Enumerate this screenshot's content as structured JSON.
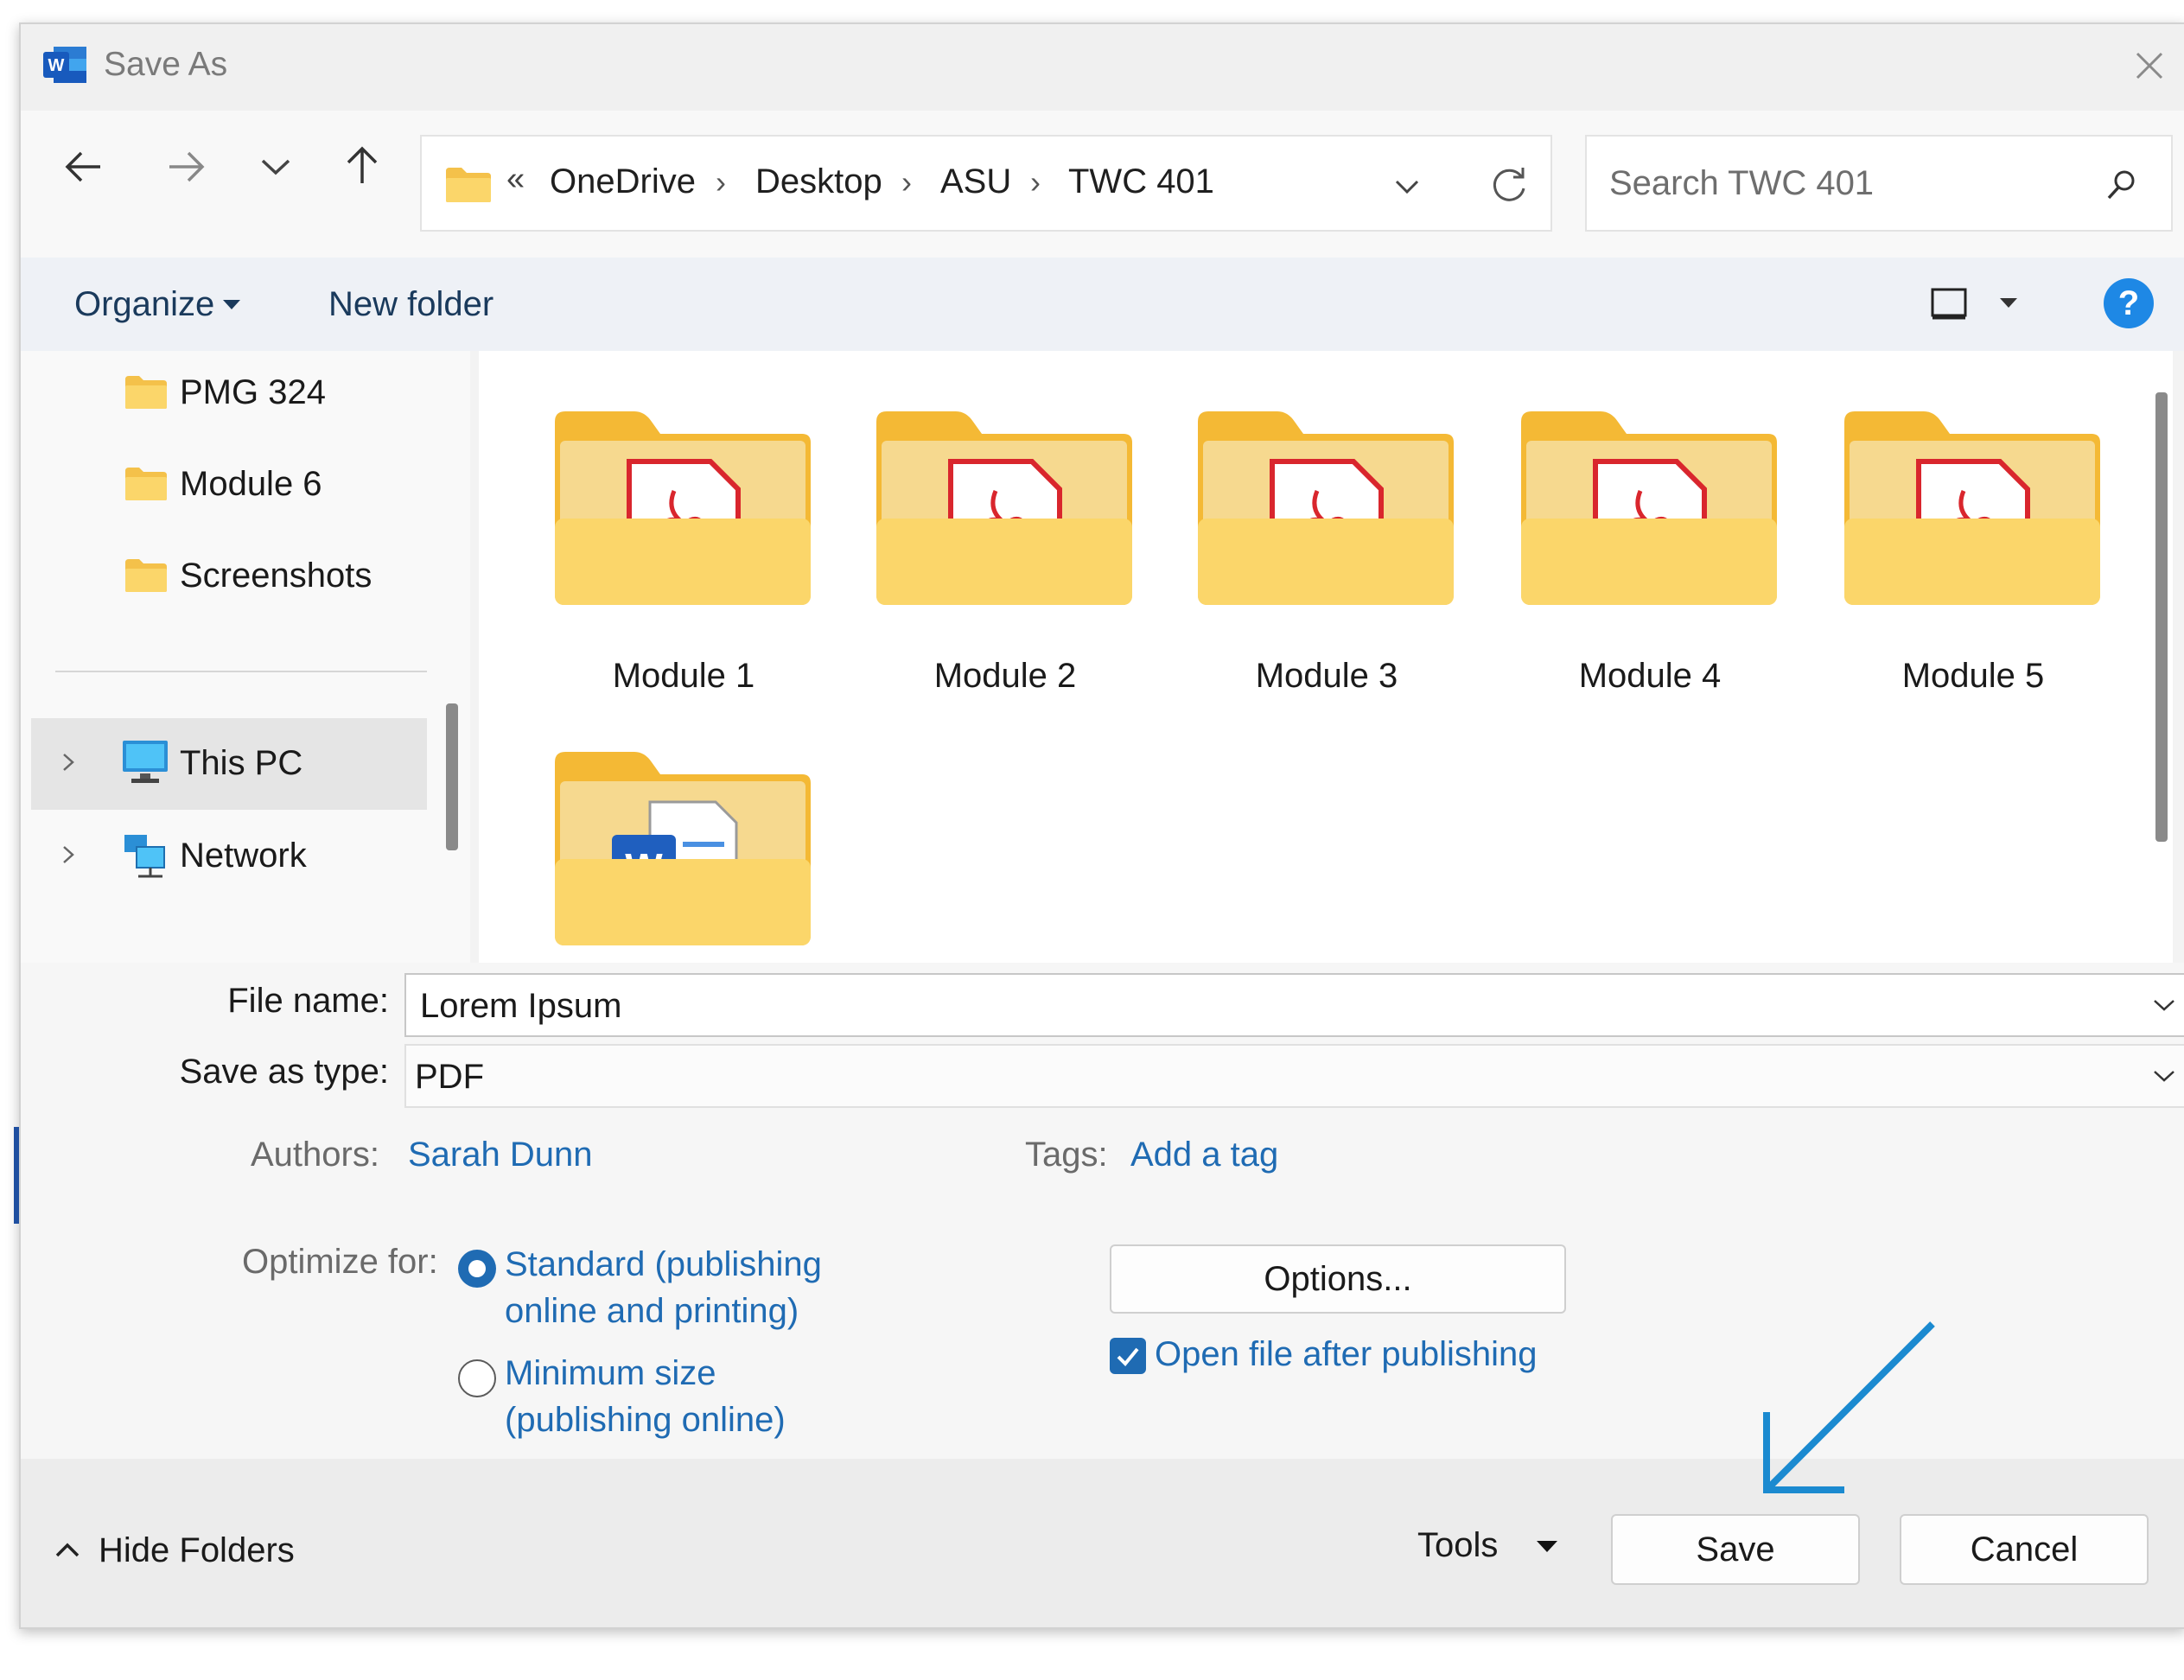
{
  "window": {
    "title": "Save As",
    "app_icon": "word-icon",
    "close_icon": "close-icon"
  },
  "nav": {
    "back_icon": "arrow-left-icon",
    "forward_icon": "arrow-right-icon",
    "recent_icon": "chevron-down-icon",
    "up_icon": "arrow-up-icon",
    "breadcrumb_prefix": "«",
    "breadcrumb": [
      "OneDrive",
      "Desktop",
      "ASU",
      "TWC 401"
    ],
    "separator": "›",
    "refresh_icon": "refresh-icon"
  },
  "search": {
    "placeholder": "Search TWC 401",
    "icon": "search-icon"
  },
  "toolbar": {
    "organize_label": "Organize",
    "new_folder_label": "New folder",
    "view_icon": "view-icon",
    "help_label": "?"
  },
  "sidebar": {
    "folders": [
      "PMG 324",
      "Module 6",
      "Screenshots"
    ],
    "locations": [
      {
        "label": "This PC",
        "icon": "monitor-icon",
        "selected": true
      },
      {
        "label": "Network",
        "icon": "network-icon",
        "selected": false
      }
    ]
  },
  "content": {
    "folders": [
      {
        "label": "Module 1",
        "icon": "pdf-folder-icon"
      },
      {
        "label": "Module 2",
        "icon": "pdf-folder-icon"
      },
      {
        "label": "Module 3",
        "icon": "pdf-folder-icon"
      },
      {
        "label": "Module 4",
        "icon": "pdf-folder-icon"
      },
      {
        "label": "Module 5",
        "icon": "pdf-folder-icon"
      }
    ],
    "partial_folder_icon": "word-folder-icon"
  },
  "form": {
    "file_name_label": "File name:",
    "file_name_value": "Lorem Ipsum",
    "save_type_label": "Save as type:",
    "save_type_value": "PDF",
    "authors_label": "Authors:",
    "authors_value": "Sarah Dunn",
    "tags_label": "Tags:",
    "tags_value": "Add a tag",
    "optimize_label": "Optimize for:",
    "optimize_options": [
      {
        "line1": "Standard (publishing",
        "line2": "online and printing)",
        "selected": true
      },
      {
        "line1": "Minimum size",
        "line2": "(publishing online)",
        "selected": false
      }
    ],
    "options_button": "Options...",
    "open_after_label": "Open file after publishing",
    "open_after_checked": true
  },
  "footer": {
    "hide_folders_label": "Hide Folders",
    "tools_label": "Tools",
    "save_label": "Save",
    "cancel_label": "Cancel"
  },
  "colors": {
    "accent": "#1f6bb3",
    "annotation_arrow": "#1b8ad0",
    "folder_yellow": "#f6c74a",
    "pdf_red": "#d9262d"
  }
}
